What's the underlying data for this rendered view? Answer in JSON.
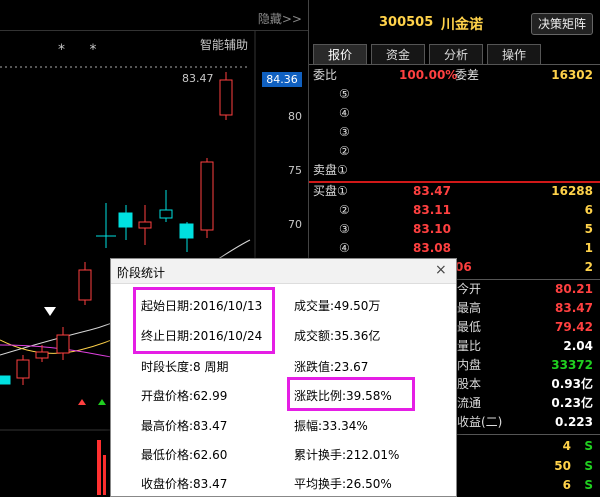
{
  "chart_pane": {
    "hide_label": "隐藏>>",
    "smart_assist": "智能辅助",
    "stars": "* *",
    "current_price_flag": "84.36",
    "peak_label": "83.47",
    "y_ticks": [
      "80",
      "75",
      "70"
    ]
  },
  "quote_header": {
    "code": "300505",
    "name": "川金诺",
    "decision_button": "决策矩阵",
    "tabs": [
      "报价",
      "资金",
      "分析",
      "操作"
    ]
  },
  "order_book": {
    "committee_label": "委比",
    "committee_ratio": "100.00%",
    "committee_diff_label": "委差",
    "committee_diff": "16302",
    "sell_rows": [
      "⑤",
      "④",
      "③",
      "②"
    ],
    "sell1_label": "卖盘①",
    "buy1_label": "买盘①",
    "buy1_price": "83.47",
    "buy1_vol": "16288",
    "buy_rows": [
      {
        "idx": "②",
        "price": "83.11",
        "vol": "6"
      },
      {
        "idx": "③",
        "price": "83.10",
        "vol": "5"
      },
      {
        "idx": "④",
        "price": "83.08",
        "vol": "1"
      },
      {
        "idx": "",
        "price": "06",
        "vol": "2"
      }
    ]
  },
  "quote_stats": [
    {
      "label": "今开",
      "value": "80.21",
      "color": "#ff4040"
    },
    {
      "label": "最高",
      "value": "83.47",
      "color": "#ff4040"
    },
    {
      "label": "最低",
      "value": "79.42",
      "color": "#ff4040"
    },
    {
      "label": "量比",
      "value": "2.04",
      "color": "#ffffff"
    },
    {
      "label": "内盘",
      "value": "33372",
      "color": "#20d020"
    },
    {
      "label": "股本",
      "value": "0.93亿",
      "color": "#ffffff"
    },
    {
      "label": "流通",
      "value": "0.23亿",
      "color": "#ffffff"
    },
    {
      "label": "收益(二)",
      "value": "0.223",
      "color": "#ffffff"
    }
  ],
  "trades": [
    {
      "vol": "4",
      "side": "S"
    },
    {
      "vol": "50",
      "side": "S"
    },
    {
      "vol": "6",
      "side": "S"
    }
  ],
  "dialog": {
    "title": "阶段统计",
    "close_icon": "×",
    "left": [
      "起始日期:2016/10/13",
      "终止日期:2016/10/24",
      "时段长度:8 周期",
      "开盘价格:62.99",
      "最高价格:83.47",
      "最低价格:62.60",
      "收盘价格:83.47"
    ],
    "right": [
      "成交量:49.50万",
      "成交额:35.36亿",
      "涨跌值:23.67",
      "涨跌比例:39.58%",
      "振幅:33.34%",
      "累计换手:212.01%",
      "平均换手:26.50%"
    ]
  },
  "colors": {
    "up": "#ff4040",
    "down": "#00e0e0",
    "accent": "#ffd24a",
    "highlight": "#e51ee5"
  }
}
